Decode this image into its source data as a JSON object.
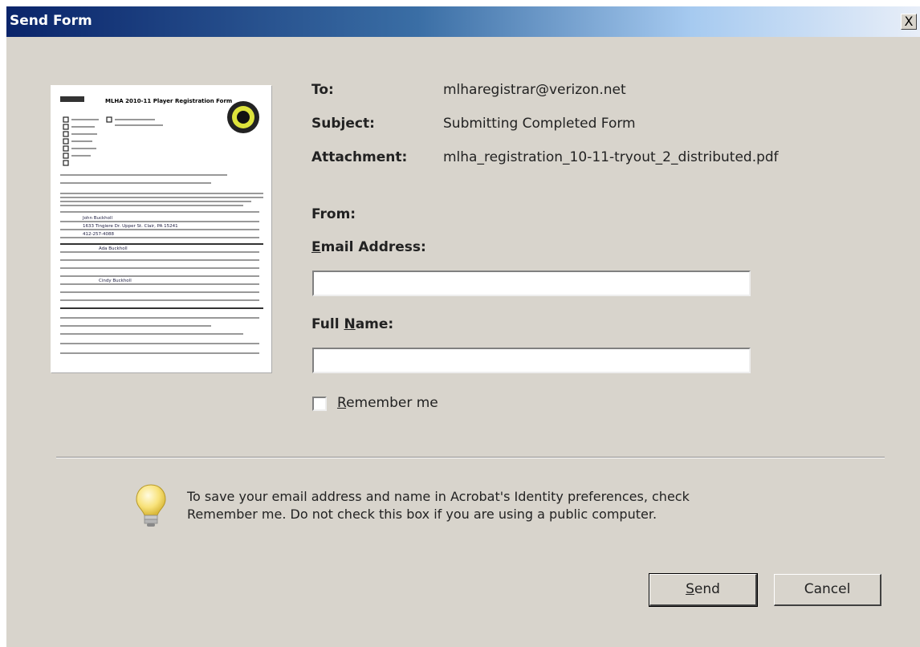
{
  "window": {
    "title": "Send Form",
    "close_glyph": "X"
  },
  "thumbnail": {
    "icon": "pdf-preview",
    "form_title": "MLHA 2010-11 Player Registration Form",
    "fields": [
      "John Buckholl",
      "1633 Tingiere Dr. Upper St. Clair, PA 15241",
      "412-257-4088",
      "Ada Buckholl",
      "Cindy Buckholl"
    ]
  },
  "fields": {
    "to_label": "To:",
    "to_value": "mlharegistrar@verizon.net",
    "subject_label": "Subject:",
    "subject_value": "Submitting Completed Form",
    "attachment_label": "Attachment:",
    "attachment_value": "mlha_registration_10-11-tryout_2_distributed.pdf",
    "from_label": "From:",
    "email_label_pre": "",
    "email_label_u": "E",
    "email_label_post": "mail Address:",
    "email_value": "",
    "name_label_pre": "Full ",
    "name_label_u": "N",
    "name_label_post": "ame:",
    "name_value": ""
  },
  "remember": {
    "label_u": "R",
    "label_rest": "emember me",
    "checked": false
  },
  "info": {
    "icon": "lightbulb-icon",
    "line1": "To save your email address and name in Acrobat's Identity preferences, check",
    "line2": "Remember me. Do not check this box if you are using a public computer."
  },
  "buttons": {
    "send_u": "S",
    "send_rest": "end",
    "cancel": "Cancel"
  }
}
